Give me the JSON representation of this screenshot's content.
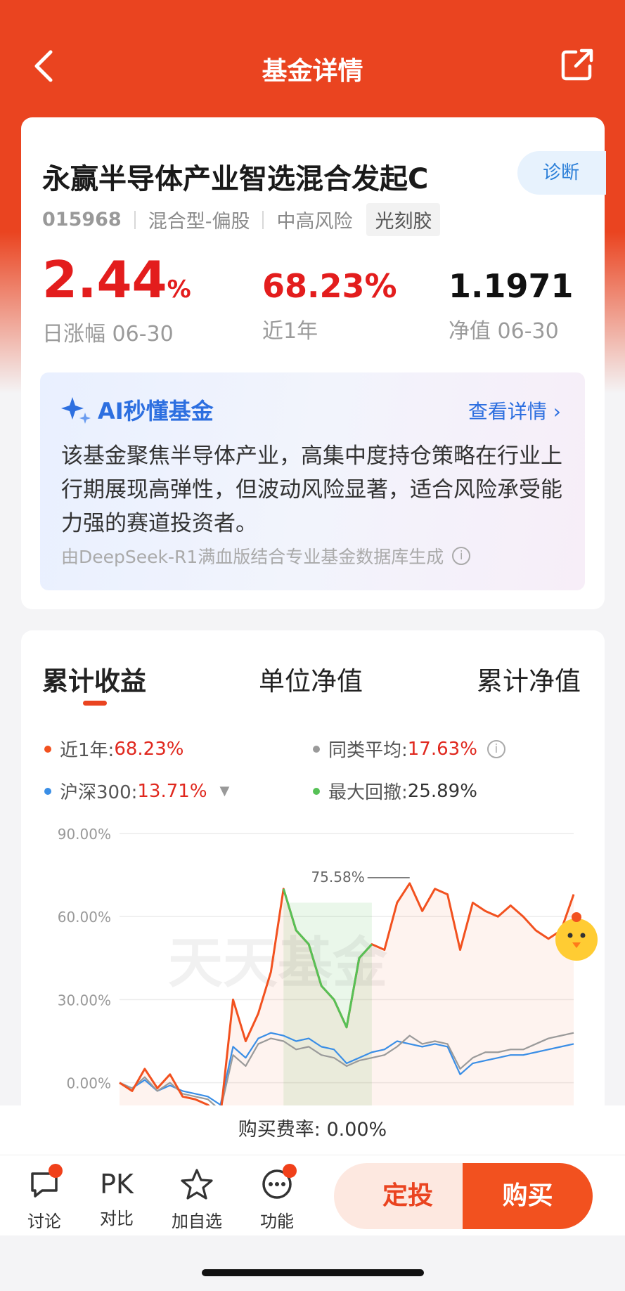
{
  "header": {
    "title": "基金详情"
  },
  "fund": {
    "name": "永赢半导体产业智选混合发起C",
    "diagnose_label": "诊断",
    "code": "015968",
    "type": "混合型-偏股",
    "risk": "中高风险",
    "theme_tag": "光刻胶",
    "daily_change": "2.44",
    "daily_change_unit": "%",
    "daily_change_label": "日涨幅 06-30",
    "one_year_return": "68.23%",
    "one_year_label": "近1年",
    "nav": "1.1971",
    "nav_label": "净值 06-30"
  },
  "ai": {
    "title": "AI秒懂基金",
    "more_label": "查看详情 ›",
    "summary": "该基金聚焦半导体产业，高集中度持仓策略在行业上行期展现高弹性，但波动风险显著，适合风险承受能力强的赛道投资者。",
    "footer": "由DeepSeek-R1满血版结合专业基金数据库生成"
  },
  "chart_tabs": [
    "累计收益",
    "单位净值",
    "累计净值"
  ],
  "legend": {
    "fund": {
      "label": "近1年:",
      "value": "68.23%",
      "color": "#f2511f"
    },
    "peer": {
      "label": "同类平均:",
      "value": "17.63%",
      "color": "#9a9a9a"
    },
    "index": {
      "label": "沪深300:",
      "value": "13.71%",
      "color": "#3a8ee6"
    },
    "drawdown": {
      "label": "最大回撤:",
      "value": "25.89%",
      "color": "#56c156"
    }
  },
  "watermark": "天天基金",
  "chart_data": {
    "type": "line",
    "y_ticks": [
      "90.00%",
      "60.00%",
      "30.00%",
      "0.00%"
    ],
    "ylim": [
      -10,
      90
    ],
    "peak_label": "75.58%",
    "series": [
      {
        "name": "近1年",
        "color": "#f2511f",
        "values": [
          0,
          -3,
          5,
          -2,
          3,
          -5,
          -6,
          -8,
          -12,
          30,
          15,
          25,
          40,
          70,
          55,
          50,
          35,
          30,
          20,
          45,
          50,
          48,
          65,
          72,
          62,
          70,
          68,
          48,
          65,
          62,
          60,
          64,
          60,
          55,
          52,
          55,
          68
        ]
      },
      {
        "name": "同类平均",
        "color": "#9a9a9a",
        "values": [
          0,
          -2,
          2,
          -3,
          0,
          -4,
          -5,
          -6,
          -10,
          10,
          6,
          14,
          16,
          15,
          12,
          13,
          10,
          9,
          6,
          8,
          9,
          10,
          13,
          17,
          14,
          15,
          14,
          5,
          9,
          11,
          11,
          12,
          12,
          14,
          16,
          17,
          18
        ]
      },
      {
        "name": "沪深300",
        "color": "#3a8ee6",
        "values": [
          0,
          -2,
          1,
          -3,
          -1,
          -3,
          -4,
          -5,
          -8,
          13,
          9,
          16,
          18,
          17,
          15,
          16,
          13,
          12,
          7,
          9,
          11,
          12,
          15,
          14,
          13,
          14,
          13,
          3,
          7,
          8,
          9,
          10,
          10,
          11,
          12,
          13,
          14
        ]
      }
    ],
    "drawdown_range_index": [
      13,
      20
    ]
  },
  "bottom": {
    "fee_text": "购买费率: 0.00%",
    "discuss_label": "讨论",
    "pk_icon_text": "PK",
    "compare_label": "对比",
    "watchlist_label": "加自选",
    "function_label": "功能",
    "sip_button": "定投",
    "buy_button": "购买"
  }
}
